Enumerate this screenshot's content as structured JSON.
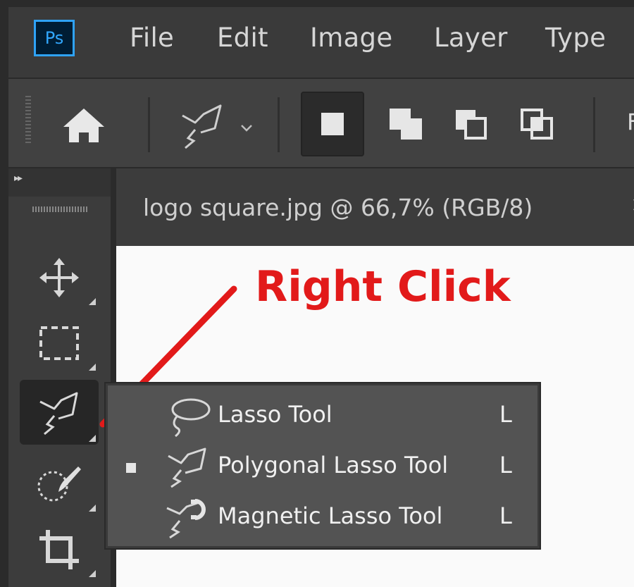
{
  "app": {
    "logo_text": "Ps"
  },
  "menu": {
    "items": [
      "File",
      "Edit",
      "Image",
      "Layer",
      "Type"
    ]
  },
  "options_bar": {
    "active_tool_icon": "polygonal-lasso-icon",
    "selection_modes": [
      "new-selection-icon",
      "add-to-selection-icon",
      "subtract-from-selection-icon",
      "intersect-selection-icon"
    ],
    "cut_text": "F"
  },
  "toolbar": {
    "tools": [
      "move-tool-icon",
      "rectangular-marquee-icon",
      "polygonal-lasso-icon",
      "quick-selection-icon",
      "crop-tool-icon"
    ]
  },
  "document": {
    "tab_title": "logo square.jpg @ 66,7% (RGB/8)",
    "tab_close": "×"
  },
  "annotation": {
    "text": "Right Click",
    "color": "#e21a1a"
  },
  "flyout": {
    "items": [
      {
        "label": "Lasso Tool",
        "shortcut": "L",
        "icon": "lasso-icon",
        "selected": false
      },
      {
        "label": "Polygonal Lasso Tool",
        "shortcut": "L",
        "icon": "polygonal-lasso-icon",
        "selected": true
      },
      {
        "label": "Magnetic Lasso Tool",
        "shortcut": "L",
        "icon": "magnetic-lasso-icon",
        "selected": false
      }
    ]
  },
  "colors": {
    "ps_blue": "#31a8ff",
    "panel": "#3c3c3c",
    "flyout": "#535353"
  }
}
